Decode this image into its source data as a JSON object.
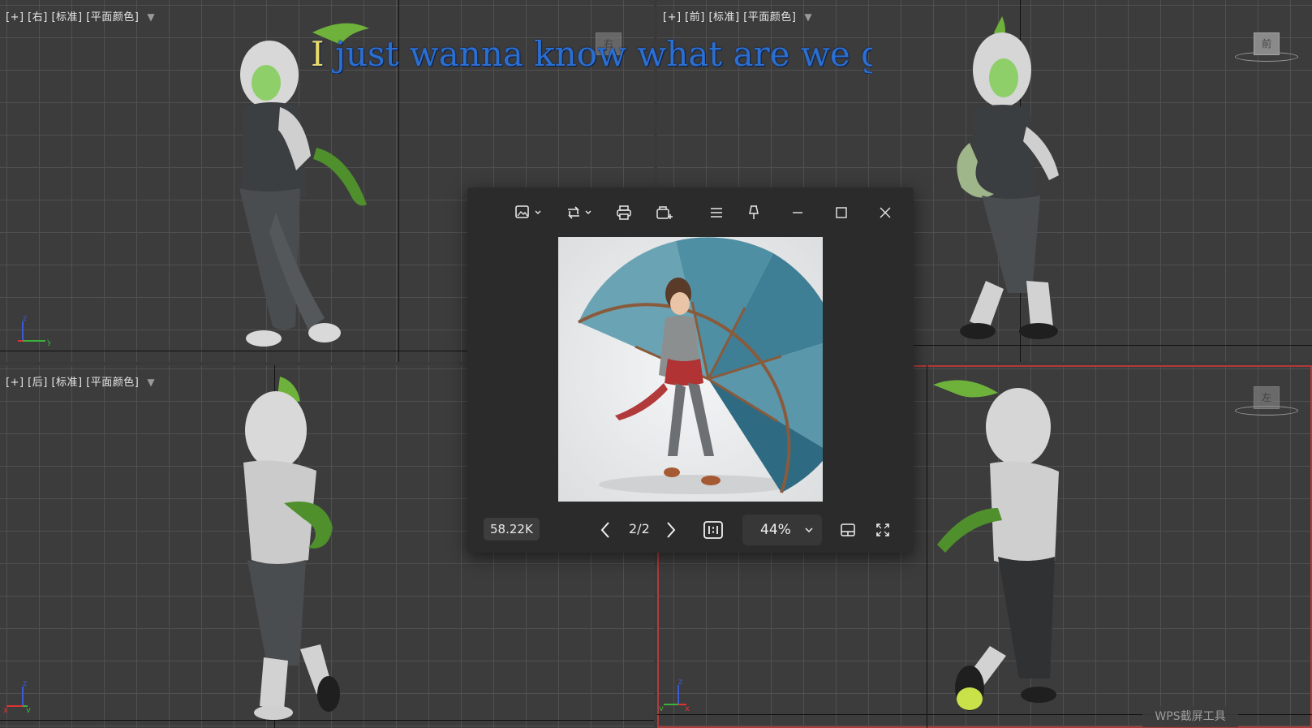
{
  "viewports": {
    "top_left": {
      "label": "[+] [右] [标准] [平面颜色]",
      "viewcube": "右",
      "axes": {
        "z": "z",
        "x": "x",
        "y": "y"
      }
    },
    "top_right": {
      "label": "[+] [前] [标准] [平面颜色]",
      "viewcube": "前"
    },
    "bottom_left": {
      "label": "[+] [后] [标准] [平面颜色]",
      "axes": {
        "z": "z",
        "x": "x",
        "y": "y"
      }
    },
    "bottom_right": {
      "viewcube": "左",
      "axes": {
        "z": "z",
        "x": "x",
        "y": "y"
      }
    }
  },
  "lyrics": {
    "first": "I",
    "rest": " just wanna know what are we gonna"
  },
  "viewer": {
    "file_size": "58.22K",
    "page": "2/2",
    "zoom": "44%",
    "icons": {
      "edit": "image-edit-icon",
      "rotate": "rotate-icon",
      "print": "print-icon",
      "save": "save-as-icon",
      "menu": "menu-icon",
      "pin": "pin-icon",
      "minimize": "minimize-icon",
      "maximize": "maximize-icon",
      "close": "close-icon",
      "prev": "chevron-left-icon",
      "next": "chevron-right-icon",
      "actual_size": "actual-size-icon",
      "layout": "layout-icon",
      "fullscreen": "fullscreen-icon"
    }
  },
  "watermark": "WPS截屏工具",
  "colors": {
    "selection_border": "#b03a3a",
    "viewport_bg": "#3c3c3c",
    "viewer_bg": "#2b2b2b"
  }
}
